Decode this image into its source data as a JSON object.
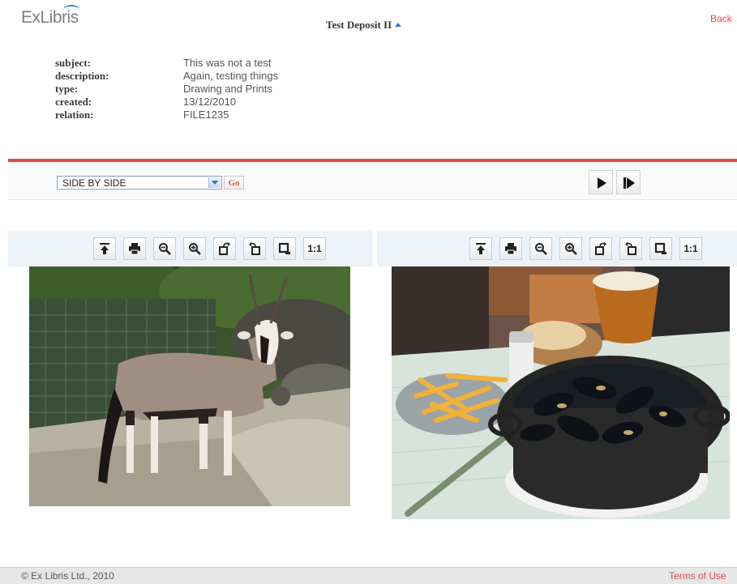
{
  "header": {
    "logo": "ExLibris",
    "title": "Test Deposit II",
    "back_label": "Back"
  },
  "metadata": [
    {
      "key": "subject:",
      "value": "This was not a test"
    },
    {
      "key": "description:",
      "value": "Again, testing things"
    },
    {
      "key": "type:",
      "value": "Drawing and Prints"
    },
    {
      "key": "created:",
      "value": "13/12/2010"
    },
    {
      "key": "relation:",
      "value": "FILE1235"
    }
  ],
  "controls": {
    "view_mode_selected": "SIDE BY SIDE",
    "go_label": "Go",
    "play_icon": "play-icon",
    "next_icon": "step-forward-icon"
  },
  "viewer_tools": {
    "download_icon": "download-icon",
    "print_icon": "print-icon",
    "zoom_out_icon": "zoom-out-icon",
    "zoom_in_icon": "zoom-in-icon",
    "rotate_left_icon": "rotate-left-icon",
    "rotate_right_icon": "rotate-right-icon",
    "fit_icon": "fit-window-icon",
    "actual_size_label": "1:1"
  },
  "images": [
    {
      "name": "oryx-photo"
    },
    {
      "name": "mussels-fries-beer-photo"
    }
  ],
  "footer": {
    "copyright": "© Ex Libris Ltd., 2010",
    "terms": "Terms of Use"
  },
  "colors": {
    "accent_red": "#e34a4d",
    "link_red": "#e04a4a",
    "toolbar_bg": "#edf2f8"
  }
}
